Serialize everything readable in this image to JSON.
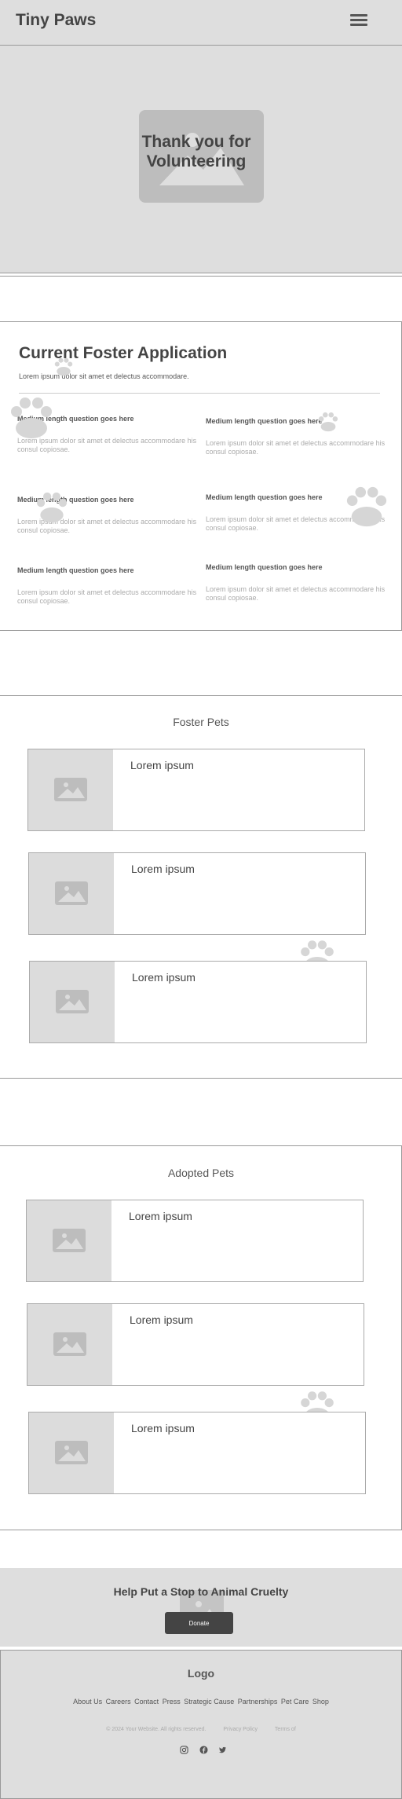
{
  "header": {
    "brand": "Tiny Paws",
    "menu_icon": "hamburger-menu-icon"
  },
  "hero": {
    "title": "Thank you for Volunteering",
    "image_icon": "image-placeholder-icon"
  },
  "application": {
    "title": "Current Foster Application",
    "subtitle": "Lorem ipsum dolor sit amet et delectus accommodare.",
    "questions": [
      {
        "q": "Medium length question goes here",
        "a": "Lorem ipsum dolor sit amet et delectus accommodare his consul copiosae."
      },
      {
        "q": "Medium length question goes here",
        "a": "Lorem ipsum dolor sit amet et delectus accommodare his consul copiosae."
      },
      {
        "q": "Medium length question goes here",
        "a": "Lorem ipsum dolor sit amet et delectus accommodare his consul copiosae."
      },
      {
        "q": "Medium length question goes here",
        "a": "Lorem ipsum dolor sit amet et delectus accommodare his consul copiosae."
      },
      {
        "q": "Medium length question goes here",
        "a": "Lorem ipsum dolor sit amet et delectus accommodare his consul copiosae."
      },
      {
        "q": "Medium length question goes here",
        "a": "Lorem ipsum dolor sit amet et delectus accommodare his consul copiosae."
      }
    ]
  },
  "foster_pets": {
    "title": "Foster Pets",
    "cards": [
      "Lorem ipsum",
      "Lorem ipsum",
      "Lorem ipsum"
    ]
  },
  "adopted_pets": {
    "title": "Adopted Pets",
    "cards": [
      "Lorem ipsum",
      "Lorem ipsum",
      "Lorem ipsum"
    ]
  },
  "cta": {
    "title": "Help Put a Stop to Animal Cruelty",
    "button": "Donate"
  },
  "footer": {
    "logo": "Logo",
    "links": [
      "About Us",
      "Careers",
      "Contact",
      "Press",
      "Strategic Cause",
      "Partnerships",
      "Pet Care",
      "Shop"
    ],
    "copyright": "© 2024 Your Website. All rights reserved.",
    "privacy": "Privacy Policy",
    "terms": "Terms of",
    "social_icons": [
      "instagram-icon",
      "facebook-icon",
      "twitter-icon"
    ]
  },
  "colors": {
    "panel": "#dedede",
    "placeholder": "#bdbdbd",
    "button": "#444444",
    "paw": "#d6d6d6"
  }
}
